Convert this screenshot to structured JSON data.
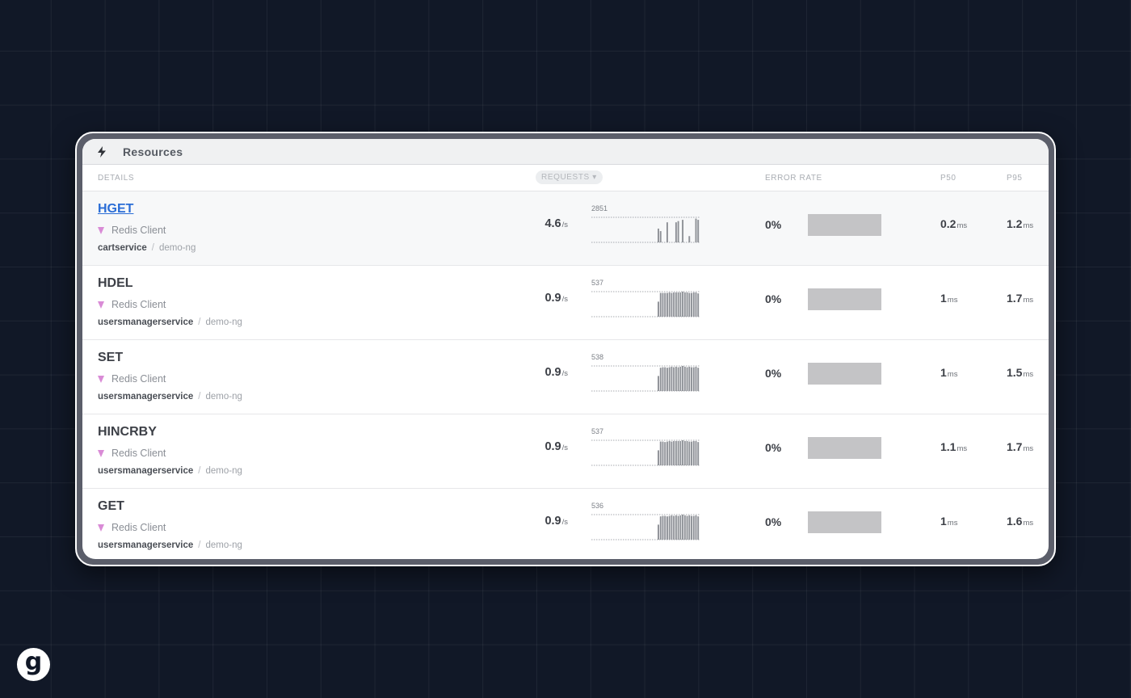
{
  "panel": {
    "title": "Resources",
    "icon": "lightning-bolt-icon"
  },
  "columns": {
    "details": "DETAILS",
    "requests": "REQUESTS ▾",
    "error_rate": "ERROR RATE",
    "p50": "P50",
    "p95": "P95"
  },
  "rows": [
    {
      "name": "HGET",
      "type": "Redis Client",
      "service": "cartservice",
      "sep": "/",
      "env": "demo-ng",
      "rate": "4.6",
      "rate_unit": "/s",
      "spark_max": "2851",
      "spark_values": [
        0,
        0,
        0,
        0,
        0,
        0,
        0,
        0,
        0,
        0,
        0,
        0,
        0,
        0,
        0,
        0,
        0,
        0,
        0,
        0,
        0,
        0,
        0,
        0,
        0,
        0,
        0,
        0,
        0,
        0,
        0.55,
        0.45,
        0,
        0,
        0.8,
        0,
        0,
        0,
        0.8,
        0.85,
        0,
        0.9,
        0,
        0,
        0.25,
        0,
        0,
        0.95,
        0.9
      ],
      "error_rate": "0%",
      "error_fraction": 0,
      "p50": "0.2",
      "p95": "1.2",
      "unit": "ms"
    },
    {
      "name": "HDEL",
      "type": "Redis Client",
      "service": "usersmanagerservice",
      "sep": "/",
      "env": "demo-ng",
      "rate": "0.9",
      "rate_unit": "/s",
      "spark_max": "537",
      "spark_values": [
        0,
        0,
        0,
        0,
        0,
        0,
        0,
        0,
        0,
        0,
        0,
        0,
        0,
        0,
        0,
        0,
        0,
        0,
        0,
        0,
        0,
        0,
        0,
        0,
        0,
        0,
        0,
        0,
        0,
        0,
        0.6,
        0.95,
        0.95,
        0.95,
        0.95,
        0.97,
        0.95,
        0.97,
        0.97,
        0.97,
        0.97,
        1,
        0.97,
        0.97,
        0.95,
        0.95,
        0.97,
        0.97,
        0.93
      ],
      "error_rate": "0%",
      "error_fraction": 0,
      "p50": "1",
      "p95": "1.7",
      "unit": "ms"
    },
    {
      "name": "SET",
      "type": "Redis Client",
      "service": "usersmanagerservice",
      "sep": "/",
      "env": "demo-ng",
      "rate": "0.9",
      "rate_unit": "/s",
      "spark_max": "538",
      "spark_values": [
        0,
        0,
        0,
        0,
        0,
        0,
        0,
        0,
        0,
        0,
        0,
        0,
        0,
        0,
        0,
        0,
        0,
        0,
        0,
        0,
        0,
        0,
        0,
        0,
        0,
        0,
        0,
        0,
        0,
        0,
        0.6,
        0.93,
        0.95,
        0.95,
        0.93,
        0.95,
        0.97,
        0.95,
        0.97,
        0.95,
        0.97,
        1,
        0.97,
        0.95,
        0.97,
        0.95,
        0.95,
        0.97,
        0.93
      ],
      "error_rate": "0%",
      "error_fraction": 0,
      "p50": "1",
      "p95": "1.5",
      "unit": "ms"
    },
    {
      "name": "HINCRBY",
      "type": "Redis Client",
      "service": "usersmanagerservice",
      "sep": "/",
      "env": "demo-ng",
      "rate": "0.9",
      "rate_unit": "/s",
      "spark_max": "537",
      "spark_values": [
        0,
        0,
        0,
        0,
        0,
        0,
        0,
        0,
        0,
        0,
        0,
        0,
        0,
        0,
        0,
        0,
        0,
        0,
        0,
        0,
        0,
        0,
        0,
        0,
        0,
        0,
        0,
        0,
        0,
        0,
        0.6,
        0.95,
        0.95,
        0.93,
        0.95,
        0.97,
        0.95,
        0.97,
        0.97,
        0.97,
        0.97,
        1,
        0.97,
        0.97,
        0.95,
        0.95,
        0.97,
        0.97,
        0.93
      ],
      "error_rate": "0%",
      "error_fraction": 0,
      "p50": "1.1",
      "p95": "1.7",
      "unit": "ms"
    },
    {
      "name": "GET",
      "type": "Redis Client",
      "service": "usersmanagerservice",
      "sep": "/",
      "env": "demo-ng",
      "rate": "0.9",
      "rate_unit": "/s",
      "spark_max": "536",
      "spark_values": [
        0,
        0,
        0,
        0,
        0,
        0,
        0,
        0,
        0,
        0,
        0,
        0,
        0,
        0,
        0,
        0,
        0,
        0,
        0,
        0,
        0,
        0,
        0,
        0,
        0,
        0,
        0,
        0,
        0,
        0,
        0.6,
        0.93,
        0.95,
        0.95,
        0.93,
        0.95,
        0.97,
        0.95,
        0.97,
        0.95,
        0.97,
        1,
        0.97,
        0.95,
        0.97,
        0.95,
        0.95,
        0.97,
        0.93
      ],
      "error_rate": "0%",
      "error_fraction": 0,
      "p50": "1",
      "p95": "1.6",
      "unit": "ms"
    }
  ],
  "logo": {
    "letter": "g",
    "icon": "brand-logo-icon"
  }
}
